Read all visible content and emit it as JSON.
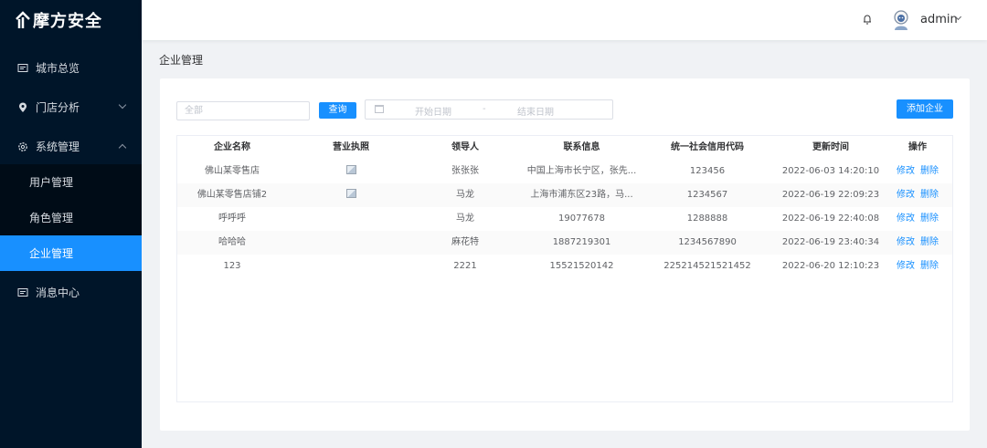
{
  "brand": {
    "name": "摩方安全"
  },
  "sidebar": {
    "items": [
      {
        "label": "城市总览",
        "icon": "monitor-icon"
      },
      {
        "label": "门店分析",
        "icon": "location-icon"
      },
      {
        "label": "系统管理",
        "icon": "gear-icon"
      },
      {
        "label": "消息中心",
        "icon": "message-icon"
      }
    ],
    "submenu": [
      {
        "label": "用户管理"
      },
      {
        "label": "角色管理"
      },
      {
        "label": "企业管理"
      }
    ]
  },
  "header": {
    "user": "admin",
    "accent": "#1890ff"
  },
  "page": {
    "title": "企业管理"
  },
  "filters": {
    "search_placeholder": "全部",
    "query_label": "查询",
    "start_date": "开始日期",
    "separator": "-",
    "end_date": "结束日期",
    "add_label": "添加企业"
  },
  "table": {
    "columns": [
      "企业名称",
      "营业执照",
      "领导人",
      "联系信息",
      "统一社会信用代码",
      "更新时间",
      "操作"
    ],
    "rows": [
      {
        "name": "佛山某零售店",
        "leader": "张张张",
        "contact": "中国上海市长宁区，张先...",
        "code": "123456",
        "updated": "2022-06-03 14:20:10"
      },
      {
        "name": "佛山某零售店铺2",
        "leader": "马龙",
        "contact": "上海市浦东区23路，马...",
        "code": "1234567",
        "updated": "2022-06-19 22:09:23"
      },
      {
        "name": "呼呼呼",
        "leader": "马龙",
        "contact": "19077678",
        "code": "1288888",
        "updated": "2022-06-19 22:40:08"
      },
      {
        "name": "哈哈哈",
        "leader": "麻花特",
        "contact": "1887219301",
        "code": "1234567890",
        "updated": "2022-06-19 23:40:34"
      },
      {
        "name": "123",
        "leader": "2221",
        "contact": "15521520142",
        "code": "225214521521452",
        "updated": "2022-06-20 12:10:23"
      }
    ],
    "edit_label": "修改",
    "delete_label": "删除"
  }
}
